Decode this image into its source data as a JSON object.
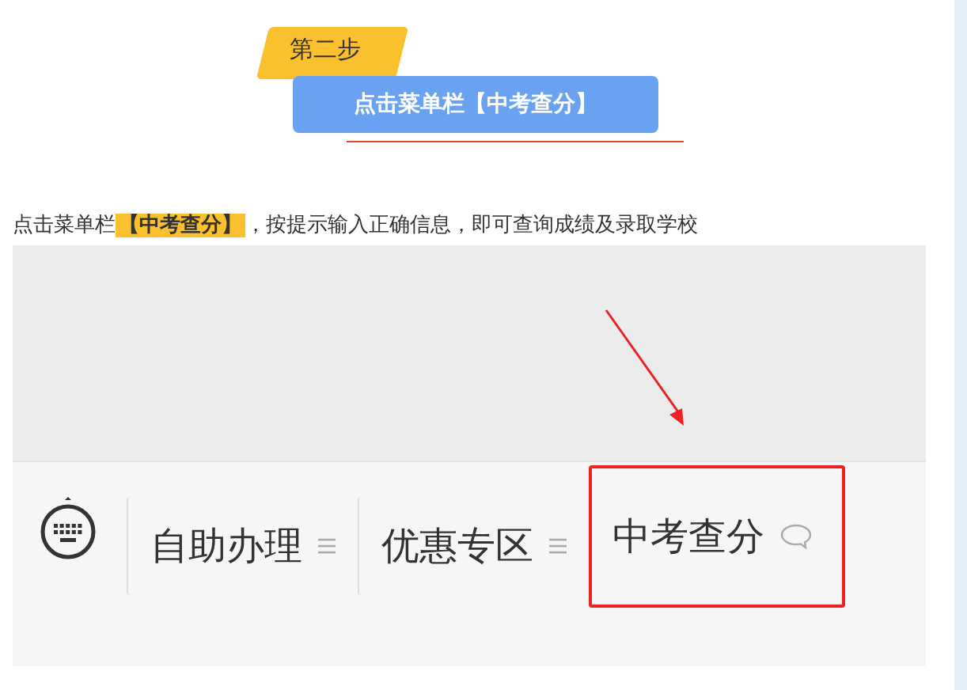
{
  "step": {
    "label": "第二步",
    "title": "点击菜单栏【中考查分】"
  },
  "instruction": "点击菜单栏**【中考查分】**，按提示输入正确信息，即可查询成绩及录取学校",
  "screenshot": {
    "menu_items": [
      {
        "label": "自助办理",
        "kind": "submenu",
        "highlighted": false
      },
      {
        "label": "优惠专区",
        "kind": "submenu",
        "highlighted": false
      },
      {
        "label": "中考查分",
        "kind": "page",
        "highlighted": true
      }
    ]
  }
}
